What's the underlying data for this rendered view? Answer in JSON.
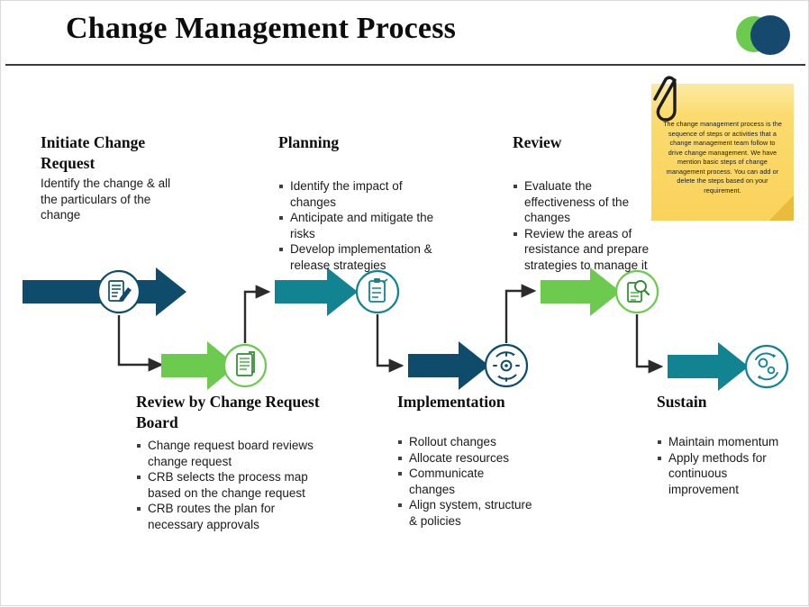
{
  "header": {
    "title": "Change Management Process",
    "logo": {
      "back_color": "#6CCB4F",
      "front_color": "#15496E"
    }
  },
  "note": {
    "text": "The change management process is the sequence of steps or activities that a change management team follow to drive change management. We have mention basic steps of change management process. You can add or delete the steps based on your requirement.",
    "color": "#FBDB6F"
  },
  "palette": {
    "navy": "#0F4C6B",
    "green": "#6CCB4F",
    "teal": "#128391",
    "connector": "#2b2b2b"
  },
  "stages": [
    {
      "key": "initiate",
      "heading": "Initiate Change Request",
      "body": "Identify the change & all the particulars of the change",
      "bullets": [],
      "color": "#0F4C6B",
      "icon": "document-pencil-icon"
    },
    {
      "key": "review-board",
      "heading": "Review by Change Request Board",
      "body": "",
      "bullets": [
        "Change request board reviews change request",
        "CRB  selects the process map based on the change request",
        "CRB routes the plan for necessary approvals"
      ],
      "color": "#6CCB4F",
      "icon": "document-lines-icon"
    },
    {
      "key": "planning",
      "heading": "Planning",
      "body": "",
      "bullets": [
        "Identify the impact of changes",
        "Anticipate and mitigate the risks",
        "Develop implementation & release strategies"
      ],
      "color": "#128391",
      "icon": "clipboard-checklist-icon"
    },
    {
      "key": "implementation",
      "heading": "Implementation",
      "body": "",
      "bullets": [
        "Rollout  changes",
        "Allocate resources",
        "Communicate changes",
        "Align system, structure & policies"
      ],
      "color": "#0F4C6B",
      "icon": "gear-cycle-icon"
    },
    {
      "key": "review",
      "heading": "Review",
      "body": "",
      "bullets": [
        "Evaluate the effectiveness of the changes",
        "Review the areas of resistance and prepare strategies to manage it"
      ],
      "color": "#6CCB4F",
      "icon": "document-magnifier-icon"
    },
    {
      "key": "sustain",
      "heading": "Sustain",
      "body": "",
      "bullets": [
        "Maintain momentum",
        "Apply methods for continuous improvement"
      ],
      "color": "#128391",
      "icon": "gears-refresh-icon"
    }
  ]
}
